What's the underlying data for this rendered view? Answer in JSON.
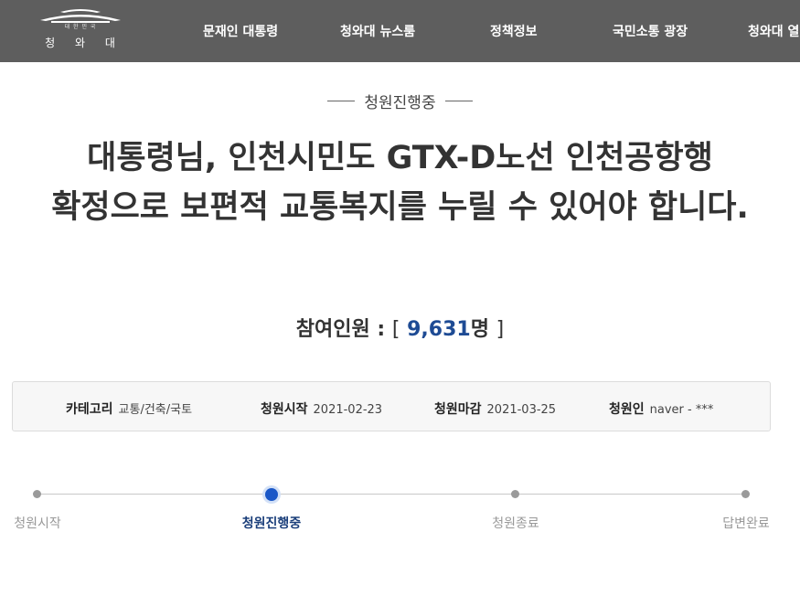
{
  "header": {
    "logo": {
      "org_text": "대 한 민 국",
      "name": "청 와 대"
    },
    "nav": [
      {
        "label": "문재인 대통령"
      },
      {
        "label": "청와대 뉴스룸"
      },
      {
        "label": "정책정보"
      },
      {
        "label": "국민소통 광장"
      },
      {
        "label": "청와대 열"
      }
    ],
    "background_color": "#5e5e5e"
  },
  "petition": {
    "status": "청원진행중",
    "title": "대통령님, 인천시민도 GTX-D노선 인천공항행 확정으로 보편적 교통복지를 누릴 수 있어야 합니다.",
    "participants": {
      "label": "참여인원 :",
      "open_bracket": "[",
      "count": "9,631",
      "unit": "명",
      "close_bracket": "]"
    },
    "info": {
      "category": {
        "key": "카테고리",
        "value": "교통/건축/국토"
      },
      "start": {
        "key": "청원시작",
        "value": "2021-02-23"
      },
      "end": {
        "key": "청원마감",
        "value": "2021-03-25"
      },
      "author": {
        "key": "청원인",
        "value": "naver - ***"
      }
    },
    "progress": {
      "steps": [
        {
          "label": "청원시작"
        },
        {
          "label": "청원진행중"
        },
        {
          "label": "청원종료"
        },
        {
          "label": "답변완료"
        }
      ],
      "active_step": "청원진행중",
      "accent_color": "#1a57c7"
    }
  }
}
